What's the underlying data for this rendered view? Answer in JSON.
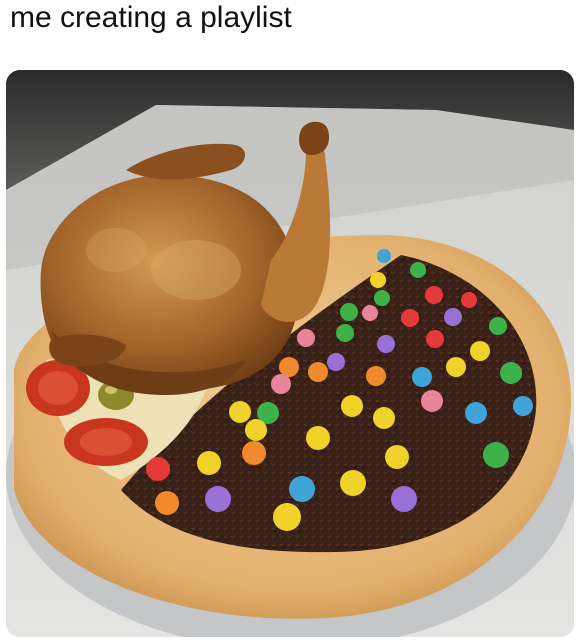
{
  "post": {
    "caption": "me creating a playlist"
  },
  "photo": {
    "subject_icon": "pizza-chicken-candy-icon"
  },
  "colors": {
    "crust": "#e6b878",
    "chocolate": "#3b2218",
    "chicken": "#a5672b",
    "tomato": "#c9361f",
    "candy": [
      "#e63a3a",
      "#f1d22a",
      "#3db24a",
      "#3fa4d8",
      "#9a6fd6",
      "#f08a2c",
      "#e9849a"
    ]
  }
}
